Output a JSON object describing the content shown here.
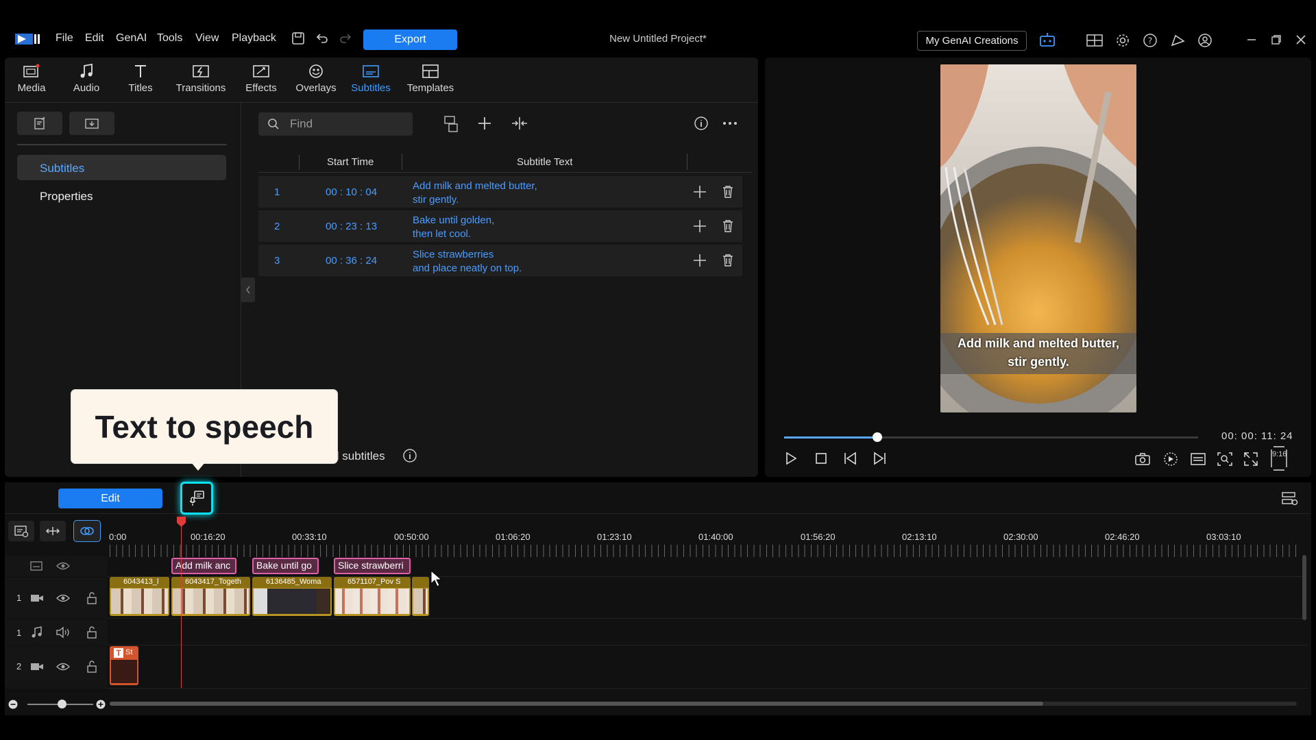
{
  "menu": [
    "File",
    "Edit",
    "GenAI",
    "Tools",
    "View",
    "Playback"
  ],
  "export_label": "Export",
  "project_title": "New Untitled Project*",
  "genai_label": "My GenAI Creations",
  "tabs": [
    {
      "label": "Media",
      "icon": "media-icon"
    },
    {
      "label": "Audio",
      "icon": "music-note-icon"
    },
    {
      "label": "Titles",
      "icon": "title-t-icon"
    },
    {
      "label": "Transitions",
      "icon": "transition-icon"
    },
    {
      "label": "Effects",
      "icon": "effects-icon"
    },
    {
      "label": "Overlays",
      "icon": "overlay-icon"
    },
    {
      "label": "Subtitles",
      "icon": "subtitles-icon",
      "active": true
    },
    {
      "label": "Templates",
      "icon": "templates-icon"
    }
  ],
  "side_nav": {
    "subtitles": "Subtitles",
    "properties": "Properties"
  },
  "search": {
    "placeholder": "Find"
  },
  "table": {
    "headers": {
      "start": "Start Time",
      "text": "Subtitle Text"
    },
    "rows": [
      {
        "n": "1",
        "time": "00 : 10 : 04",
        "line1": "Add milk and melted butter,",
        "line2": "stir gently."
      },
      {
        "n": "2",
        "time": "00 : 23 : 13",
        "line1": "Bake until golden,",
        "line2": "then let cool."
      },
      {
        "n": "3",
        "time": "00 : 36 : 24",
        "line1": "Slice strawberries",
        "line2": "and place neatly on top."
      }
    ]
  },
  "tooltip": "Text to speech",
  "all_subs_text": "ll subtitles",
  "preview": {
    "caption_line1": "Add milk and melted butter,",
    "caption_line2": "stir gently.",
    "timecode": "00: 00: 11: 24",
    "aspect": "9:16",
    "progress": 0.225
  },
  "timeline": {
    "edit_label": "Edit",
    "ticks": [
      "0:00",
      "00:16:20",
      "00:33:10",
      "00:50:00",
      "01:06:20",
      "01:23:10",
      "01:40:00",
      "01:56:20",
      "02:13:10",
      "02:30:00",
      "02:46:20",
      "03:03:10"
    ],
    "subtitle_clips": [
      "Add milk anc",
      "Bake until go",
      "Slice strawberri"
    ],
    "video_clips": [
      "6043413_l",
      "6043417_Togeth",
      "6136485_Woma",
      "6571107_Pov S",
      ""
    ],
    "title_clip": "St",
    "track_numbers": {
      "video1": "1",
      "audio1": "1",
      "video2": "2"
    }
  },
  "colors": {
    "accent": "#1a7cf0",
    "highlight": "#0fe0ef",
    "subtitle_clip": "#e060a8",
    "video_clip": "#b8951f",
    "playhead": "#e03a3a"
  }
}
